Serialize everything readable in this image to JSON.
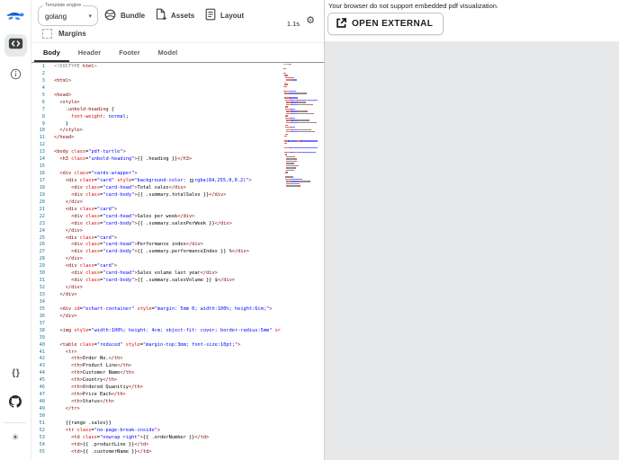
{
  "toolbar": {
    "template_engine_label": "Template engine",
    "template_engine_value": "golang",
    "bundle_label": "Bundle",
    "assets_label": "Assets",
    "layout_label": "Layout",
    "margins_label": "Margins",
    "render_time": "1.1s"
  },
  "icons": {
    "gear": "⚙",
    "caret": "▾",
    "braces": "{ }",
    "sun": "☀"
  },
  "editor": {
    "tabs": [
      "Body",
      "Header",
      "Footer",
      "Model"
    ],
    "active_tab": "Body",
    "lines": [
      [
        [
          "meta",
          "<!DOCTYPE "
        ],
        [
          "tag",
          "html"
        ],
        [
          "meta",
          ">"
        ]
      ],
      [],
      [
        [
          "tag",
          "<html>"
        ]
      ],
      [],
      [
        [
          "tag",
          "<head>"
        ]
      ],
      [
        [
          "sp",
          "  "
        ],
        [
          "tag",
          "<style>"
        ]
      ],
      [
        [
          "sp",
          "    "
        ],
        [
          "tag",
          ".unbold-heading"
        ],
        [
          "txt",
          " {"
        ]
      ],
      [
        [
          "sp",
          "      "
        ],
        [
          "attr",
          "font-weight"
        ],
        [
          "txt",
          ": "
        ],
        [
          "str",
          "normal"
        ],
        [
          "txt",
          ";"
        ]
      ],
      [
        [
          "sp",
          "    "
        ],
        [
          "txt",
          "}"
        ]
      ],
      [
        [
          "sp",
          "  "
        ],
        [
          "tag",
          "</style>"
        ]
      ],
      [
        [
          "tag",
          "</head>"
        ]
      ],
      [],
      [
        [
          "tag",
          "<body"
        ],
        [
          "attr",
          " class"
        ],
        [
          "txt",
          "="
        ],
        [
          "str",
          "\"pdf-turtle\""
        ],
        [
          "tag",
          ">"
        ]
      ],
      [
        [
          "sp",
          "  "
        ],
        [
          "tag",
          "<h3"
        ],
        [
          "attr",
          " class"
        ],
        [
          "txt",
          "="
        ],
        [
          "str",
          "\"unbold-heading\""
        ],
        [
          "tag",
          ">"
        ],
        [
          "txt",
          "{{ .heading }}"
        ],
        [
          "tag",
          "</h3>"
        ]
      ],
      [],
      [
        [
          "sp",
          "  "
        ],
        [
          "tag",
          "<div"
        ],
        [
          "attr",
          " class"
        ],
        [
          "txt",
          "="
        ],
        [
          "str",
          "\"cards-wrapper\""
        ],
        [
          "tag",
          ">"
        ]
      ],
      [
        [
          "sp",
          "    "
        ],
        [
          "tag",
          "<div"
        ],
        [
          "attr",
          " class"
        ],
        [
          "txt",
          "="
        ],
        [
          "str",
          "\"card\""
        ],
        [
          "attr",
          " style"
        ],
        [
          "txt",
          "="
        ],
        [
          "str",
          "\"background-color: "
        ],
        [
          "sw",
          ""
        ],
        [
          "str",
          "rgba(84,255,0,0.2)\""
        ],
        [
          "tag",
          ">"
        ]
      ],
      [
        [
          "sp",
          "      "
        ],
        [
          "tag",
          "<div"
        ],
        [
          "attr",
          " class"
        ],
        [
          "txt",
          "="
        ],
        [
          "str",
          "\"card-head\""
        ],
        [
          "tag",
          ">"
        ],
        [
          "txt",
          "Total sales"
        ],
        [
          "tag",
          "</div>"
        ]
      ],
      [
        [
          "sp",
          "      "
        ],
        [
          "tag",
          "<div"
        ],
        [
          "attr",
          " class"
        ],
        [
          "txt",
          "="
        ],
        [
          "str",
          "\"card-body\""
        ],
        [
          "tag",
          ">"
        ],
        [
          "txt",
          "{{ .summary.totalSales }}"
        ],
        [
          "tag",
          "</div>"
        ]
      ],
      [
        [
          "sp",
          "    "
        ],
        [
          "tag",
          "</div>"
        ]
      ],
      [
        [
          "sp",
          "    "
        ],
        [
          "tag",
          "<div"
        ],
        [
          "attr",
          " class"
        ],
        [
          "txt",
          "="
        ],
        [
          "str",
          "\"card\""
        ],
        [
          "tag",
          ">"
        ]
      ],
      [
        [
          "sp",
          "      "
        ],
        [
          "tag",
          "<div"
        ],
        [
          "attr",
          " class"
        ],
        [
          "txt",
          "="
        ],
        [
          "str",
          "\"card-head\""
        ],
        [
          "tag",
          ">"
        ],
        [
          "txt",
          "Sales per week"
        ],
        [
          "tag",
          "</div>"
        ]
      ],
      [
        [
          "sp",
          "      "
        ],
        [
          "tag",
          "<div"
        ],
        [
          "attr",
          " class"
        ],
        [
          "txt",
          "="
        ],
        [
          "str",
          "\"card-body\""
        ],
        [
          "tag",
          ">"
        ],
        [
          "txt",
          "{{ .summary.salesPerWeek }}"
        ],
        [
          "tag",
          "</div>"
        ]
      ],
      [
        [
          "sp",
          "    "
        ],
        [
          "tag",
          "</div>"
        ]
      ],
      [
        [
          "sp",
          "    "
        ],
        [
          "tag",
          "<div"
        ],
        [
          "attr",
          " class"
        ],
        [
          "txt",
          "="
        ],
        [
          "str",
          "\"card\""
        ],
        [
          "tag",
          ">"
        ]
      ],
      [
        [
          "sp",
          "      "
        ],
        [
          "tag",
          "<div"
        ],
        [
          "attr",
          " class"
        ],
        [
          "txt",
          "="
        ],
        [
          "str",
          "\"card-head\""
        ],
        [
          "tag",
          ">"
        ],
        [
          "txt",
          "Performance index"
        ],
        [
          "tag",
          "</div>"
        ]
      ],
      [
        [
          "sp",
          "      "
        ],
        [
          "tag",
          "<div"
        ],
        [
          "attr",
          " class"
        ],
        [
          "txt",
          "="
        ],
        [
          "str",
          "\"card-body\""
        ],
        [
          "tag",
          ">"
        ],
        [
          "txt",
          "{{ .summary.performanceIndex }} %"
        ],
        [
          "tag",
          "</div>"
        ]
      ],
      [
        [
          "sp",
          "    "
        ],
        [
          "tag",
          "</div>"
        ]
      ],
      [
        [
          "sp",
          "    "
        ],
        [
          "tag",
          "<div"
        ],
        [
          "attr",
          " class"
        ],
        [
          "txt",
          "="
        ],
        [
          "str",
          "\"card\""
        ],
        [
          "tag",
          ">"
        ]
      ],
      [
        [
          "sp",
          "      "
        ],
        [
          "tag",
          "<div"
        ],
        [
          "attr",
          " class"
        ],
        [
          "txt",
          "="
        ],
        [
          "str",
          "\"card-head\""
        ],
        [
          "tag",
          ">"
        ],
        [
          "txt",
          "Sales volume last year"
        ],
        [
          "tag",
          "</div>"
        ]
      ],
      [
        [
          "sp",
          "      "
        ],
        [
          "tag",
          "<div"
        ],
        [
          "attr",
          " class"
        ],
        [
          "txt",
          "="
        ],
        [
          "str",
          "\"card-body\""
        ],
        [
          "tag",
          ">"
        ],
        [
          "txt",
          "{{ .summary.salesVolume }} $"
        ],
        [
          "tag",
          "</div>"
        ]
      ],
      [
        [
          "sp",
          "    "
        ],
        [
          "tag",
          "</div>"
        ]
      ],
      [
        [
          "sp",
          "  "
        ],
        [
          "tag",
          "</div>"
        ]
      ],
      [],
      [
        [
          "sp",
          "  "
        ],
        [
          "tag",
          "<div"
        ],
        [
          "attr",
          " id"
        ],
        [
          "txt",
          "="
        ],
        [
          "str",
          "\"echart-container\""
        ],
        [
          "attr",
          " style"
        ],
        [
          "txt",
          "="
        ],
        [
          "str",
          "\"margin: 5mm 0; width:100%; height:6cm;\""
        ],
        [
          "tag",
          ">"
        ]
      ],
      [
        [
          "sp",
          "  "
        ],
        [
          "tag",
          "</div>"
        ]
      ],
      [],
      [
        [
          "sp",
          "  "
        ],
        [
          "tag",
          "<img"
        ],
        [
          "attr",
          " style"
        ],
        [
          "txt",
          "="
        ],
        [
          "str",
          "\"width:100%; height: 4cm; object-fit: cover; border-radius:5mm\""
        ],
        [
          "attr",
          " sr"
        ]
      ],
      [],
      [
        [
          "sp",
          "  "
        ],
        [
          "tag",
          "<table"
        ],
        [
          "attr",
          " class"
        ],
        [
          "txt",
          "="
        ],
        [
          "str",
          "\"reduced\""
        ],
        [
          "attr",
          " style"
        ],
        [
          "txt",
          "="
        ],
        [
          "str",
          "\"margin-top:3mm; font-size:10pt;\""
        ],
        [
          "tag",
          ">"
        ]
      ],
      [
        [
          "sp",
          "    "
        ],
        [
          "tag",
          "<tr>"
        ]
      ],
      [
        [
          "sp",
          "      "
        ],
        [
          "tag",
          "<th>"
        ],
        [
          "txt",
          "Order No."
        ],
        [
          "tag",
          "</th>"
        ]
      ],
      [
        [
          "sp",
          "      "
        ],
        [
          "tag",
          "<th>"
        ],
        [
          "txt",
          "Product Line"
        ],
        [
          "tag",
          "</th>"
        ]
      ],
      [
        [
          "sp",
          "      "
        ],
        [
          "tag",
          "<th>"
        ],
        [
          "txt",
          "Customer Name"
        ],
        [
          "tag",
          "</th>"
        ]
      ],
      [
        [
          "sp",
          "      "
        ],
        [
          "tag",
          "<th>"
        ],
        [
          "txt",
          "Country"
        ],
        [
          "tag",
          "</th>"
        ]
      ],
      [
        [
          "sp",
          "      "
        ],
        [
          "tag",
          "<th>"
        ],
        [
          "txt",
          "Ordered Quanitiy"
        ],
        [
          "tag",
          "</th>"
        ]
      ],
      [
        [
          "sp",
          "      "
        ],
        [
          "tag",
          "<th>"
        ],
        [
          "txt",
          "Price Each"
        ],
        [
          "tag",
          "</th>"
        ]
      ],
      [
        [
          "sp",
          "      "
        ],
        [
          "tag",
          "<th>"
        ],
        [
          "txt",
          "Status"
        ],
        [
          "tag",
          "</th>"
        ]
      ],
      [
        [
          "sp",
          "    "
        ],
        [
          "tag",
          "</tr>"
        ]
      ],
      [],
      [
        [
          "sp",
          "    "
        ],
        [
          "txt",
          "{{range .sales}}"
        ]
      ],
      [
        [
          "sp",
          "    "
        ],
        [
          "tag",
          "<tr"
        ],
        [
          "attr",
          " class"
        ],
        [
          "txt",
          "="
        ],
        [
          "str",
          "\"no-page-break-inside\""
        ],
        [
          "tag",
          ">"
        ]
      ],
      [
        [
          "sp",
          "      "
        ],
        [
          "tag",
          "<td"
        ],
        [
          "attr",
          " class"
        ],
        [
          "txt",
          "="
        ],
        [
          "str",
          "\"nowrap right\""
        ],
        [
          "tag",
          ">"
        ],
        [
          "txt",
          "{{ .orderNumber }}"
        ],
        [
          "tag",
          "</td>"
        ]
      ],
      [
        [
          "sp",
          "      "
        ],
        [
          "tag",
          "<td>"
        ],
        [
          "txt",
          "{{ .productLine }}"
        ],
        [
          "tag",
          "</td>"
        ]
      ],
      [
        [
          "sp",
          "      "
        ],
        [
          "tag",
          "<td>"
        ],
        [
          "txt",
          "{{ .customerName }}"
        ],
        [
          "tag",
          "</td>"
        ]
      ]
    ]
  },
  "preview": {
    "message": "Your browser do not support embedded pdf visualization.",
    "open_external_label": "OPEN EXTERNAL"
  },
  "colors": {
    "accent_blue": "#2574eb",
    "swatch_rgba": "rgba(84,255,0,0.2)",
    "line_number": "#237893",
    "pdf_area_gray": "#e7e8ea"
  }
}
